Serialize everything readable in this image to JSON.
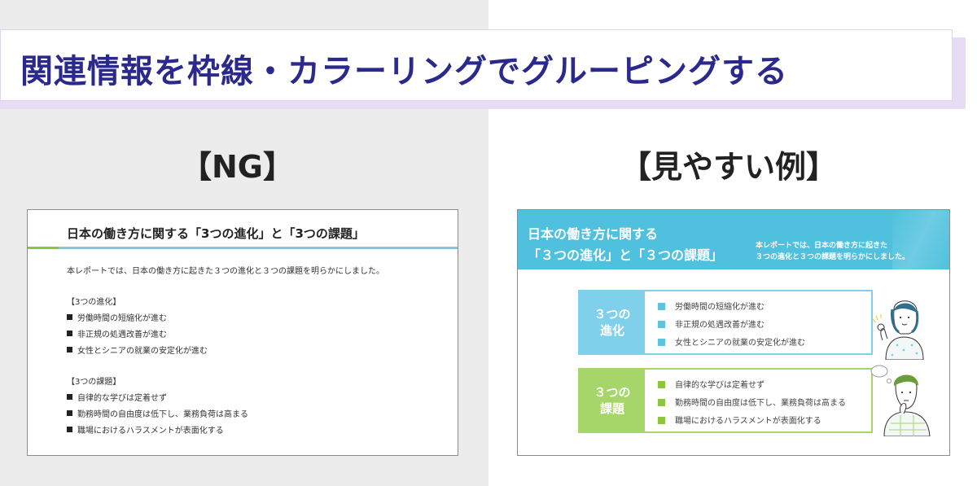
{
  "headline": "関連情報を枠線・カラーリングでグルーピングする",
  "ng_section": {
    "title": "【NG】",
    "slide_title": "日本の働き方に関する「3つの進化」と「3つの課題」",
    "intro": "本レポートでは、日本の働き方に起きた３つの進化と３つの課題を明らかにしました。",
    "evolution_heading": "【3つの進化】",
    "evolutions": [
      "労働時間の短縮化が進む",
      "非正規の処遇改善が進む",
      "女性とシニアの就業の安定化が進む"
    ],
    "issues_heading": "【3つの課題】",
    "issues": [
      "自律的な学びは定着せず",
      "勤務時間の自由度は低下し、業務負荷は高まる",
      "職場におけるハラスメントが表面化する"
    ]
  },
  "ok_section": {
    "title": "【見やすい例】",
    "header_line1": "日本の働き方に関する",
    "header_line2": "「３つの進化」と「３つの課題」",
    "desc_line1": "本レポートでは、日本の働き方に起きた",
    "desc_line2": "３つの進化と３つの課題を明らかにしました。",
    "group1_label_1": "３つの",
    "group1_label_2": "進化",
    "group1_items": [
      "労働時間の短縮化が進む",
      "非正規の処遇改善が進む",
      "女性とシニアの就業の安定化が進む"
    ],
    "group2_label_1": "３つの",
    "group2_label_2": "課題",
    "group2_items": [
      "自律的な学びは定着せず",
      "勤務時間の自由度は低下し、業務負荷は高まる",
      "職場におけるハラスメントが表面化する"
    ]
  },
  "colors": {
    "headline": "#2b2a8c",
    "header_blue": "#4fc1de",
    "group_blue": "#7fd0ea",
    "group_green": "#a6d66a"
  }
}
